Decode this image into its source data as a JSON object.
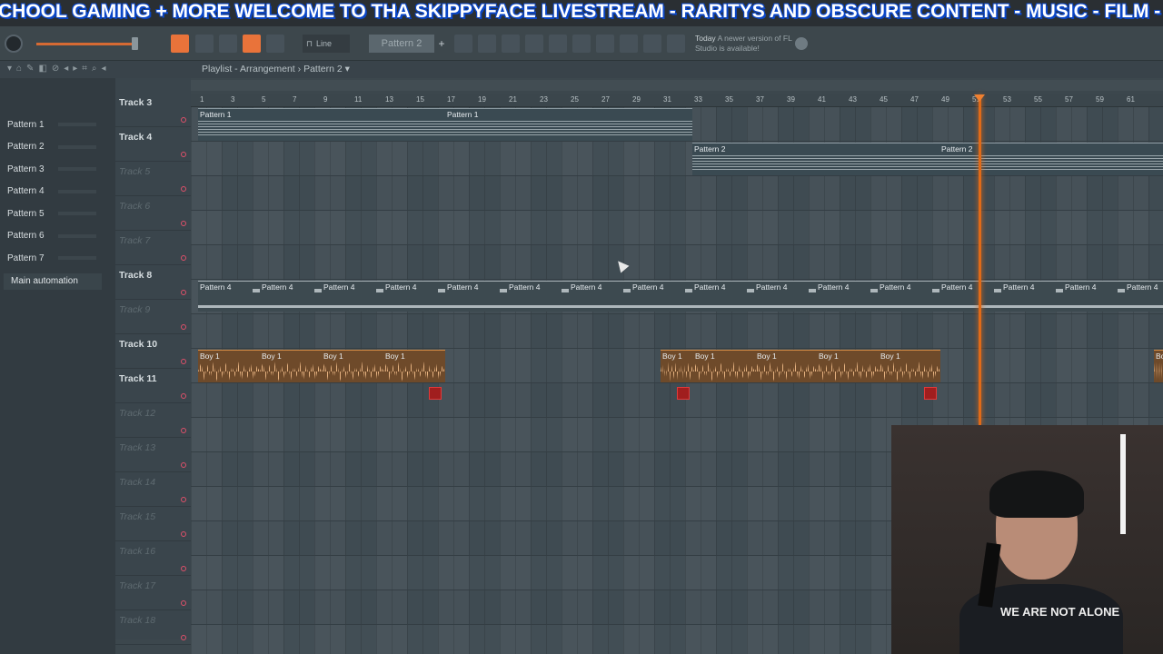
{
  "ticker": {
    "text": "CHOOL GAMING + MORE  WELCOME TO THA SKIPPYFACE LIVESTREAM  - RARITYS AND OBSCURE CONTENT - MUSIC - FILM -"
  },
  "toolbar": {
    "snap_label": "Line",
    "pattern_selector": "Pattern 2",
    "hint_prefix": "Today",
    "hint_text": "A newer version of FL Studio is available!",
    "icons": [
      "master-volume-knob",
      "pattern-song-toggle",
      "arrow-tool",
      "slide-tool",
      "link-tool",
      "stamp-tool",
      "snap-icon",
      "mixer-icon",
      "channel-rack-icon",
      "piano-roll-icon",
      "browser-icon",
      "plugin-icon",
      "project-icon",
      "shop-icon",
      "globe-icon"
    ]
  },
  "playlist": {
    "title": "Playlist - Arrangement",
    "breadcrumb_sep": "›",
    "current_pattern": "Pattern 2",
    "picker": [
      "Pattern 1",
      "Pattern 2",
      "Pattern 3",
      "Pattern 4",
      "Pattern 5",
      "Pattern 6",
      "Pattern 7"
    ],
    "automation_label": "Main automation",
    "tracks": [
      {
        "name": "Track 3",
        "empty": false
      },
      {
        "name": "Track 4",
        "empty": false
      },
      {
        "name": "Track 5",
        "empty": true
      },
      {
        "name": "Track 6",
        "empty": true
      },
      {
        "name": "Track 7",
        "empty": true
      },
      {
        "name": "Track 8",
        "empty": false
      },
      {
        "name": "Track 9",
        "empty": true
      },
      {
        "name": "Track 10",
        "empty": false
      },
      {
        "name": "Track 11",
        "empty": false
      },
      {
        "name": "Track 12",
        "empty": true
      },
      {
        "name": "Track 13",
        "empty": true
      },
      {
        "name": "Track 14",
        "empty": true
      },
      {
        "name": "Track 15",
        "empty": true
      },
      {
        "name": "Track 16",
        "empty": true
      },
      {
        "name": "Track 17",
        "empty": true
      },
      {
        "name": "Track 18",
        "empty": true
      }
    ],
    "ruler_ticks": [
      "1",
      "3",
      "5",
      "7",
      "9",
      "11",
      "13",
      "15",
      "17",
      "19",
      "21",
      "23",
      "25",
      "27",
      "29",
      "31",
      "33",
      "35",
      "37",
      "39",
      "41",
      "43",
      "45",
      "47",
      "49",
      "51",
      "53",
      "55",
      "57",
      "59",
      "61"
    ],
    "clip_labels": {
      "pattern1": "Pattern 1",
      "pattern2": "Pattern 2",
      "pattern4": "Pattern 4",
      "audio": "Boy 1"
    }
  },
  "webcam": {
    "shirt_text": "WE ARE NOT ALONE"
  }
}
